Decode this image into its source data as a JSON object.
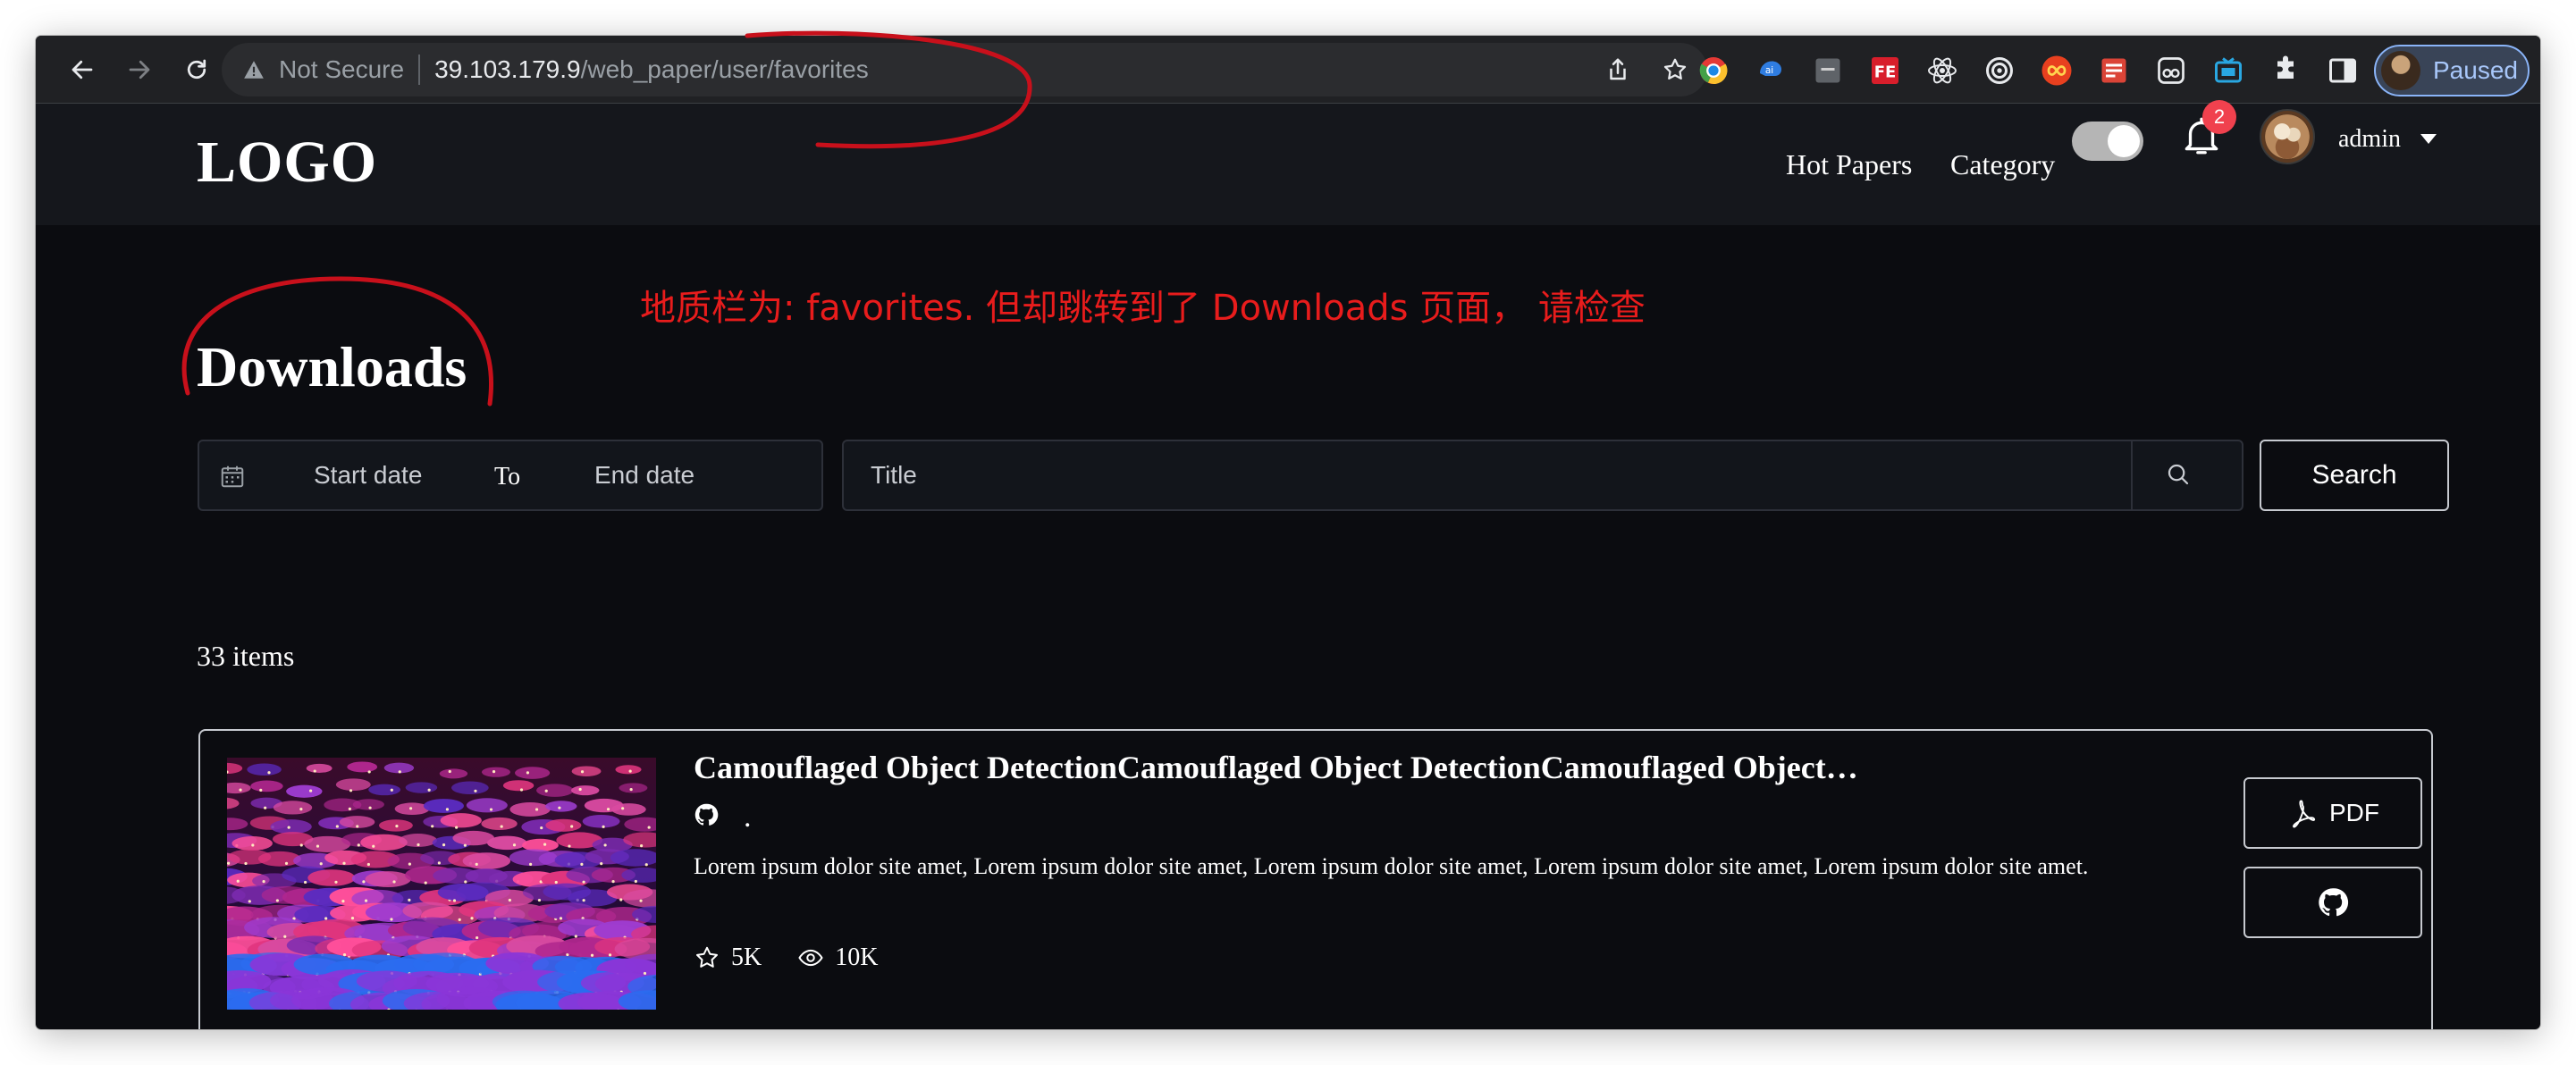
{
  "browser": {
    "address_bar": {
      "security_label": "Not Secure",
      "host": "39.103.179.9",
      "path": "/web_paper/user/favorites"
    },
    "profile_label": "Paused",
    "extensions": [
      "chrome-extension-icon",
      "translate-extension-icon",
      "generic-extension-icon",
      "fe-extension-icon",
      "react-devtools-icon",
      "target-extension-icon",
      "infinity-extension-icon",
      "todo-extension-icon",
      "reader-extension-icon",
      "tv-extension-icon",
      "extensions-puzzle-icon",
      "side-panel-icon"
    ]
  },
  "header": {
    "logo": "LOGO",
    "nav": {
      "hot_papers": "Hot Papers",
      "category": "Category"
    },
    "notifications_count": "2",
    "user_name": "admin"
  },
  "annotation": {
    "note": "地质栏为: favorites. 但却跳转到了 Downloads 页面， 请检查"
  },
  "main": {
    "title": "Downloads",
    "filters": {
      "start_date_placeholder": "Start date",
      "range_separator": "To",
      "end_date_placeholder": "End date",
      "title_placeholder": "Title",
      "search_button": "Search"
    },
    "count_label": "33 items",
    "items": [
      {
        "title": "Camouflaged Object DetectionCamouflaged Object DetectionCamouflaged Object…",
        "link_text": ".",
        "description": "Lorem ipsum dolor site amet, Lorem ipsum dolor site amet, Lorem ipsum dolor site amet, Lorem ipsum dolor site amet, Lorem ipsum dolor site amet.",
        "stars": "5K",
        "views": "10K",
        "pdf_label": "PDF"
      }
    ]
  },
  "colors": {
    "page_bg": "#0b0c10",
    "header_bg": "#15171c",
    "annotation_red": "#e81c1c",
    "badge_red": "#f0414e"
  }
}
